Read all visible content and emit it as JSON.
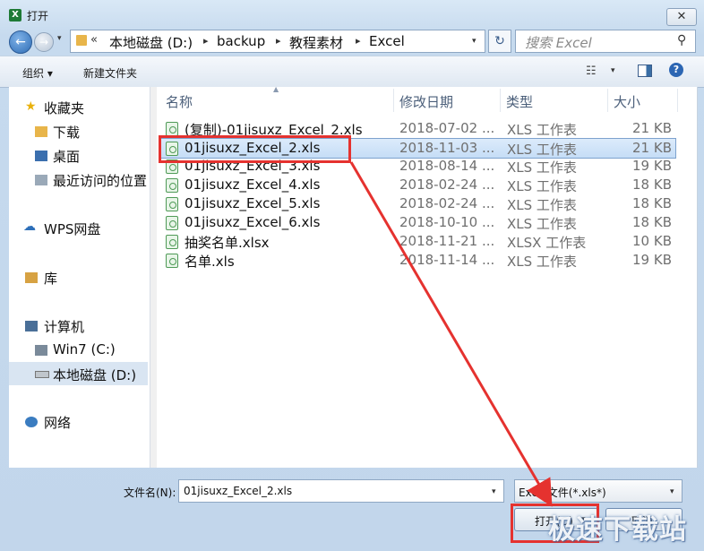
{
  "window": {
    "title": "打开",
    "app_icon": "excel-icon",
    "close_glyph": "✕"
  },
  "nav": {
    "back_glyph": "←",
    "forward_glyph": "→",
    "breadcrumb": [
      "本地磁盘 (D:)",
      "backup",
      "教程素材",
      "Excel"
    ],
    "chevron": "«",
    "refresh_glyph": "↻",
    "search_placeholder": "搜索 Excel",
    "search_icon_glyph": "⚲"
  },
  "toolbar": {
    "organize": "组织 ▾",
    "new_folder": "新建文件夹",
    "view_icon_glyph": "☷",
    "help_glyph": "?"
  },
  "sidebar": {
    "favorites": "收藏夹",
    "downloads": "下载",
    "desktop": "桌面",
    "recent": "最近访问的位置",
    "wps": "WPS网盘",
    "libraries": "库",
    "computer": "计算机",
    "drive_c": "Win7 (C:)",
    "drive_d": "本地磁盘 (D:)",
    "network": "网络"
  },
  "columns": {
    "name": "名称",
    "date": "修改日期",
    "type": "类型",
    "size": "大小"
  },
  "files": [
    {
      "name": "(复制)-01jisuxz_Excel_2.xls",
      "date": "2018-07-02 ...",
      "type": "XLS 工作表",
      "size": "21 KB"
    },
    {
      "name": "01jisuxz_Excel_2.xls",
      "date": "2018-11-03 ...",
      "type": "XLS 工作表",
      "size": "21 KB"
    },
    {
      "name": "01jisuxz_Excel_3.xls",
      "date": "2018-08-14 ...",
      "type": "XLS 工作表",
      "size": "19 KB"
    },
    {
      "name": "01jisuxz_Excel_4.xls",
      "date": "2018-02-24 ...",
      "type": "XLS 工作表",
      "size": "18 KB"
    },
    {
      "name": "01jisuxz_Excel_5.xls",
      "date": "2018-02-24 ...",
      "type": "XLS 工作表",
      "size": "18 KB"
    },
    {
      "name": "01jisuxz_Excel_6.xls",
      "date": "2018-10-10 ...",
      "type": "XLS 工作表",
      "size": "18 KB"
    },
    {
      "name": "抽奖名单.xlsx",
      "date": "2018-11-21 ...",
      "type": "XLSX 工作表",
      "size": "10 KB"
    },
    {
      "name": "名单.xls",
      "date": "2018-11-14 ...",
      "type": "XLS 工作表",
      "size": "19 KB"
    }
  ],
  "selected_index": 1,
  "bottom": {
    "filename_label": "文件名(N):",
    "filename_value": "01jisuxz_Excel_2.xls",
    "filter_value": "Excel文件(*.xls*)",
    "open_label": "打开(O)",
    "cancel_label": "取消"
  },
  "watermark": "极速下载站",
  "accent_color": "#e5322f"
}
